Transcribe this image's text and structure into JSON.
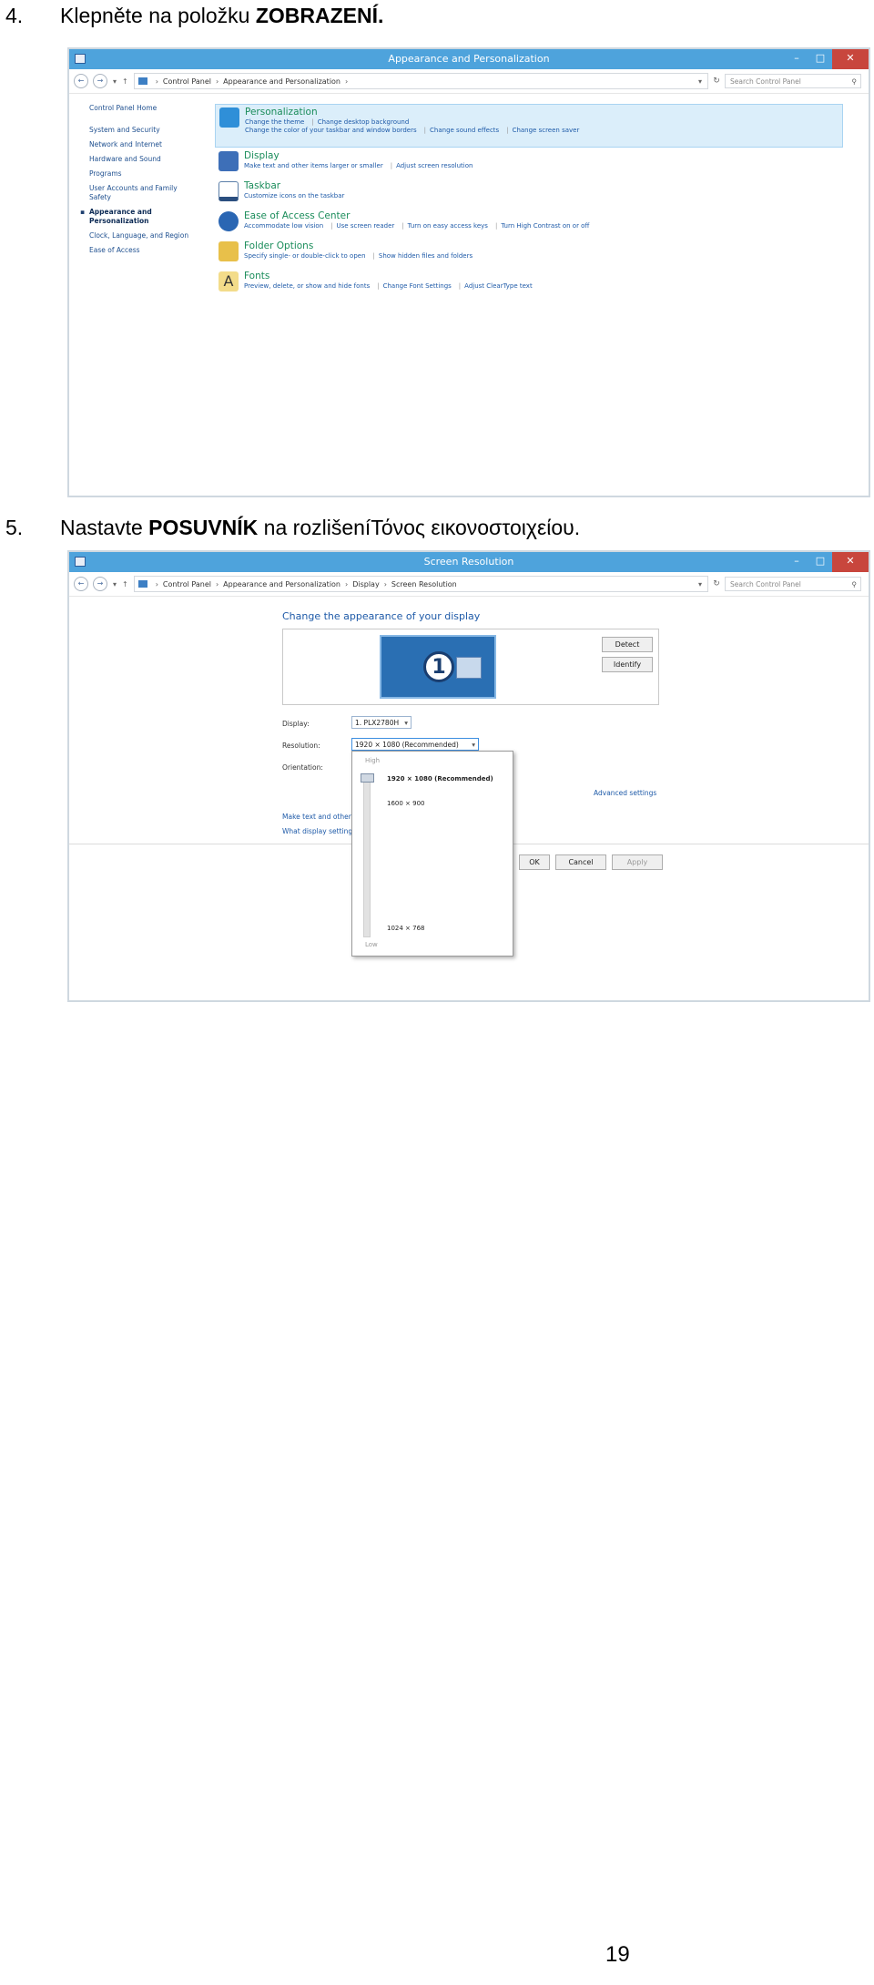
{
  "step4": {
    "num": "4.",
    "text": "Klepněte na položku ",
    "bold": "ZOBRAZENÍ."
  },
  "step5": {
    "num": "5.",
    "text_before": "Nastavte ",
    "bold": "POSUVNÍK",
    "text_after": " na rozlišeníΤόνος εικονοστοιχείου."
  },
  "shot1": {
    "title": "Appearance and Personalization",
    "crumbs": [
      "Control Panel",
      "Appearance and Personalization"
    ],
    "search_placeholder": "Search Control Panel",
    "sidebar": [
      "Control Panel Home",
      "System and Security",
      "Network and Internet",
      "Hardware and Sound",
      "Programs",
      "User Accounts and Family Safety",
      "Appearance and Personalization",
      "Clock, Language, and Region",
      "Ease of Access"
    ],
    "categories": [
      {
        "title": "Personalization",
        "links": [
          "Change the theme",
          "Change desktop background",
          "Change the color of your taskbar and window borders",
          "Change sound effects",
          "Change screen saver"
        ],
        "color": "#2f8fd8"
      },
      {
        "title": "Display",
        "links": [
          "Make text and other items larger or smaller",
          "Adjust screen resolution"
        ],
        "color": "#3d6fb8"
      },
      {
        "title": "Taskbar",
        "links": [
          "Customize icons on the taskbar"
        ],
        "color": "#5b7fa8"
      },
      {
        "title": "Ease of Access Center",
        "links": [
          "Accommodate low vision",
          "Use screen reader",
          "Turn on easy access keys",
          "Turn High Contrast on or off"
        ],
        "color": "#2a66b3"
      },
      {
        "title": "Folder Options",
        "links": [
          "Specify single- or double-click to open",
          "Show hidden files and folders"
        ],
        "color": "#e8c04a"
      },
      {
        "title": "Fonts",
        "links": [
          "Preview, delete, or show and hide fonts",
          "Change Font Settings",
          "Adjust ClearType text"
        ],
        "color": "#d9a93a"
      }
    ]
  },
  "shot2": {
    "title": "Screen Resolution",
    "crumbs": [
      "Control Panel",
      "Appearance and Personalization",
      "Display",
      "Screen Resolution"
    ],
    "search_placeholder": "Search Control Panel",
    "heading": "Change the appearance of your display",
    "monitor_number": "1",
    "detect": "Detect",
    "identify": "Identify",
    "display_label": "Display:",
    "display_value": "1. PLX2780H",
    "resolution_label": "Resolution:",
    "resolution_value": "1920 × 1080 (Recommended)",
    "orientation_label": "Orientation:",
    "advanced": "Advanced settings",
    "make_text": "Make text and other",
    "what_display": "What display setting",
    "ok": "OK",
    "cancel": "Cancel",
    "apply": "Apply",
    "slider": {
      "high": "High",
      "low": "Low",
      "opt1": "1920 × 1080 (Recommended)",
      "opt2": "1600 × 900",
      "opt3": "1024 × 768",
      "level": 1.0
    }
  },
  "page_number": "19"
}
